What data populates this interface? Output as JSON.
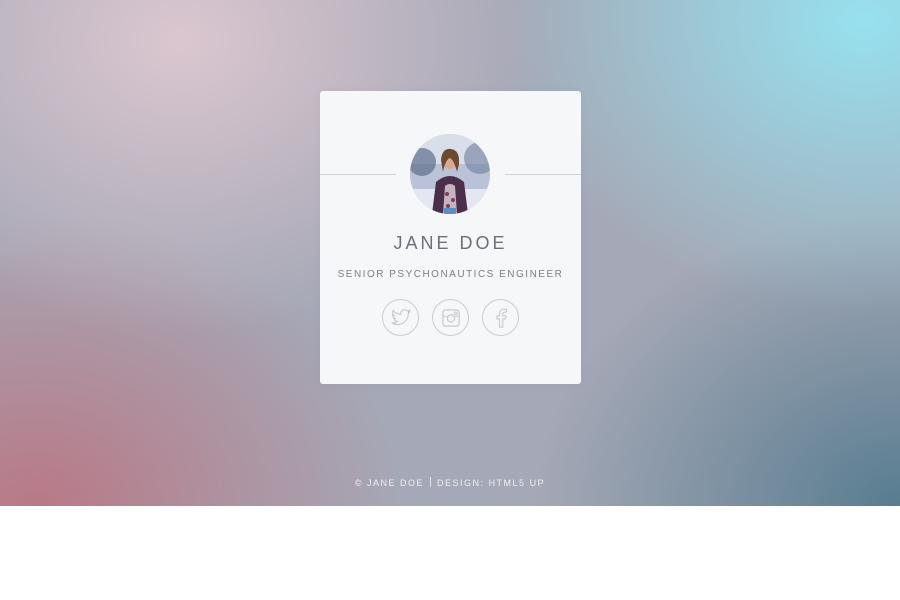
{
  "profile": {
    "name": "JANE DOE",
    "title": "SENIOR PSYCHONAUTICS ENGINEER"
  },
  "socials": [
    {
      "name": "twitter",
      "icon": "twitter-icon"
    },
    {
      "name": "instagram",
      "icon": "instagram-icon"
    },
    {
      "name": "facebook",
      "icon": "facebook-icon"
    }
  ],
  "footer": {
    "copyright": "© JANE DOE",
    "design_label": "DESIGN: ",
    "design_link": "HTML5 UP"
  },
  "colors": {
    "card": "#f6f7f9",
    "text": "#6c7079",
    "icon_stroke": "#c9ccd1",
    "footer_text": "#eef0f3"
  }
}
